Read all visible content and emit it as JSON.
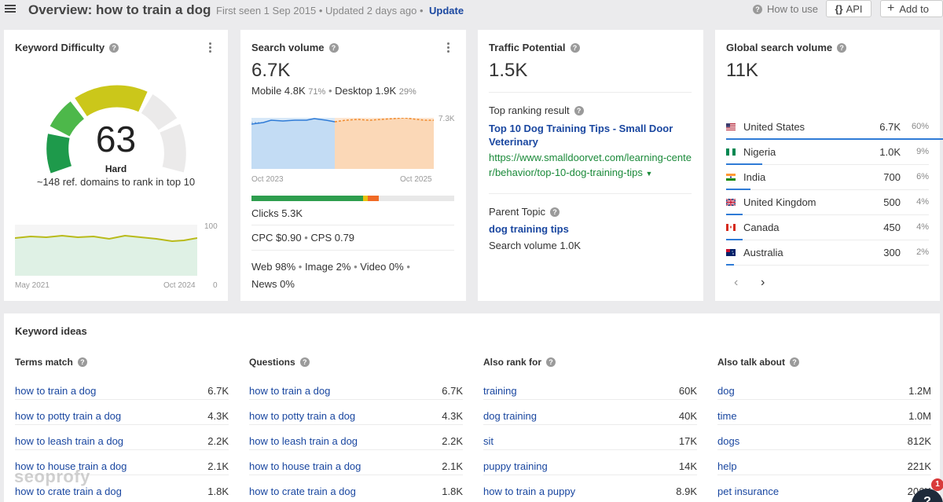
{
  "header": {
    "title": "Overview: how to train a dog",
    "first_seen": "First seen 1 Sep 2015",
    "updated": "Updated 2 days ago",
    "update_label": "Update",
    "how_to_use": "How to use",
    "api_label": "API",
    "add_to_label": "Add to"
  },
  "keyword_difficulty": {
    "title": "Keyword Difficulty",
    "value": "63",
    "level": "Hard",
    "description": "~148 ref. domains to rank in top 10",
    "chart_start": "May 2021",
    "chart_end": "Oct 2024",
    "axis_max": "100",
    "axis_min": "0"
  },
  "search_volume": {
    "title": "Search volume",
    "value": "6.7K",
    "mobile_label": "Mobile 4.8K",
    "mobile_pct": "71%",
    "desktop_label": "Desktop 1.9K",
    "desktop_pct": "29%",
    "chart_start": "Oct 2023",
    "chart_end": "Oct 2025",
    "axis_max": "7.3K",
    "clicks": "Clicks 5.3K",
    "cpc": "CPC $0.90",
    "cps": "CPS 0.79",
    "web": "Web 98%",
    "image": "Image 2%",
    "video": "Video 0%",
    "news": "News 0%"
  },
  "traffic_potential": {
    "title": "Traffic Potential",
    "value": "1.5K",
    "top_ranking_label": "Top ranking result",
    "top_result_title": "Top 10 Dog Training Tips - Small Door Veterinary",
    "top_result_url_line1": "https://www.smalldoorvet.com/learning-cente",
    "top_result_url_line2": "r/behavior/top-10-dog-training-tips",
    "parent_topic_label": "Parent Topic",
    "parent_topic": "dog training tips",
    "parent_volume": "Search volume 1.0K"
  },
  "global_volume": {
    "title": "Global search volume",
    "value": "11K",
    "countries": [
      {
        "name": "United States",
        "value": "6.7K",
        "pct": "60%",
        "share": 0.6
      },
      {
        "name": "Nigeria",
        "value": "1.0K",
        "pct": "9%",
        "share": 0.09
      },
      {
        "name": "India",
        "value": "700",
        "pct": "6%",
        "share": 0.06
      },
      {
        "name": "United Kingdom",
        "value": "500",
        "pct": "4%",
        "share": 0.04
      },
      {
        "name": "Canada",
        "value": "450",
        "pct": "4%",
        "share": 0.04
      },
      {
        "name": "Australia",
        "value": "300",
        "pct": "2%",
        "share": 0.02
      }
    ],
    "prev": "‹",
    "next": "›"
  },
  "keyword_ideas": {
    "title": "Keyword ideas",
    "columns": [
      {
        "heading": "Terms match",
        "rows": [
          {
            "kw": "how to train a dog",
            "vol": "6.7K"
          },
          {
            "kw": "how to potty train a dog",
            "vol": "4.3K"
          },
          {
            "kw": "how to leash train a dog",
            "vol": "2.2K"
          },
          {
            "kw": "how to house train a dog",
            "vol": "2.1K"
          },
          {
            "kw": "how to crate train a dog",
            "vol": "1.8K"
          }
        ]
      },
      {
        "heading": "Questions",
        "rows": [
          {
            "kw": "how to train a dog",
            "vol": "6.7K"
          },
          {
            "kw": "how to potty train a dog",
            "vol": "4.3K"
          },
          {
            "kw": "how to leash train a dog",
            "vol": "2.2K"
          },
          {
            "kw": "how to house train a dog",
            "vol": "2.1K"
          },
          {
            "kw": "how to crate train a dog",
            "vol": "1.8K"
          }
        ]
      },
      {
        "heading": "Also rank for",
        "rows": [
          {
            "kw": "training",
            "vol": "60K"
          },
          {
            "kw": "dog training",
            "vol": "40K"
          },
          {
            "kw": "sit",
            "vol": "17K"
          },
          {
            "kw": "puppy training",
            "vol": "14K"
          },
          {
            "kw": "how to train a puppy",
            "vol": "8.9K"
          }
        ]
      },
      {
        "heading": "Also talk about",
        "rows": [
          {
            "kw": "dog",
            "vol": "1.2M"
          },
          {
            "kw": "time",
            "vol": "1.0M"
          },
          {
            "kw": "dogs",
            "vol": "812K"
          },
          {
            "kw": "help",
            "vol": "221K"
          },
          {
            "kw": "pet insurance",
            "vol": "206K"
          }
        ]
      }
    ]
  },
  "watermark": "seoprofy",
  "help": {
    "label": "?",
    "badge": "1"
  },
  "colors": {
    "link": "#1a47a0",
    "url": "#1b8a3a",
    "gauge_hard": "#e8c20e",
    "bar_blue": "#2f7bd6"
  }
}
